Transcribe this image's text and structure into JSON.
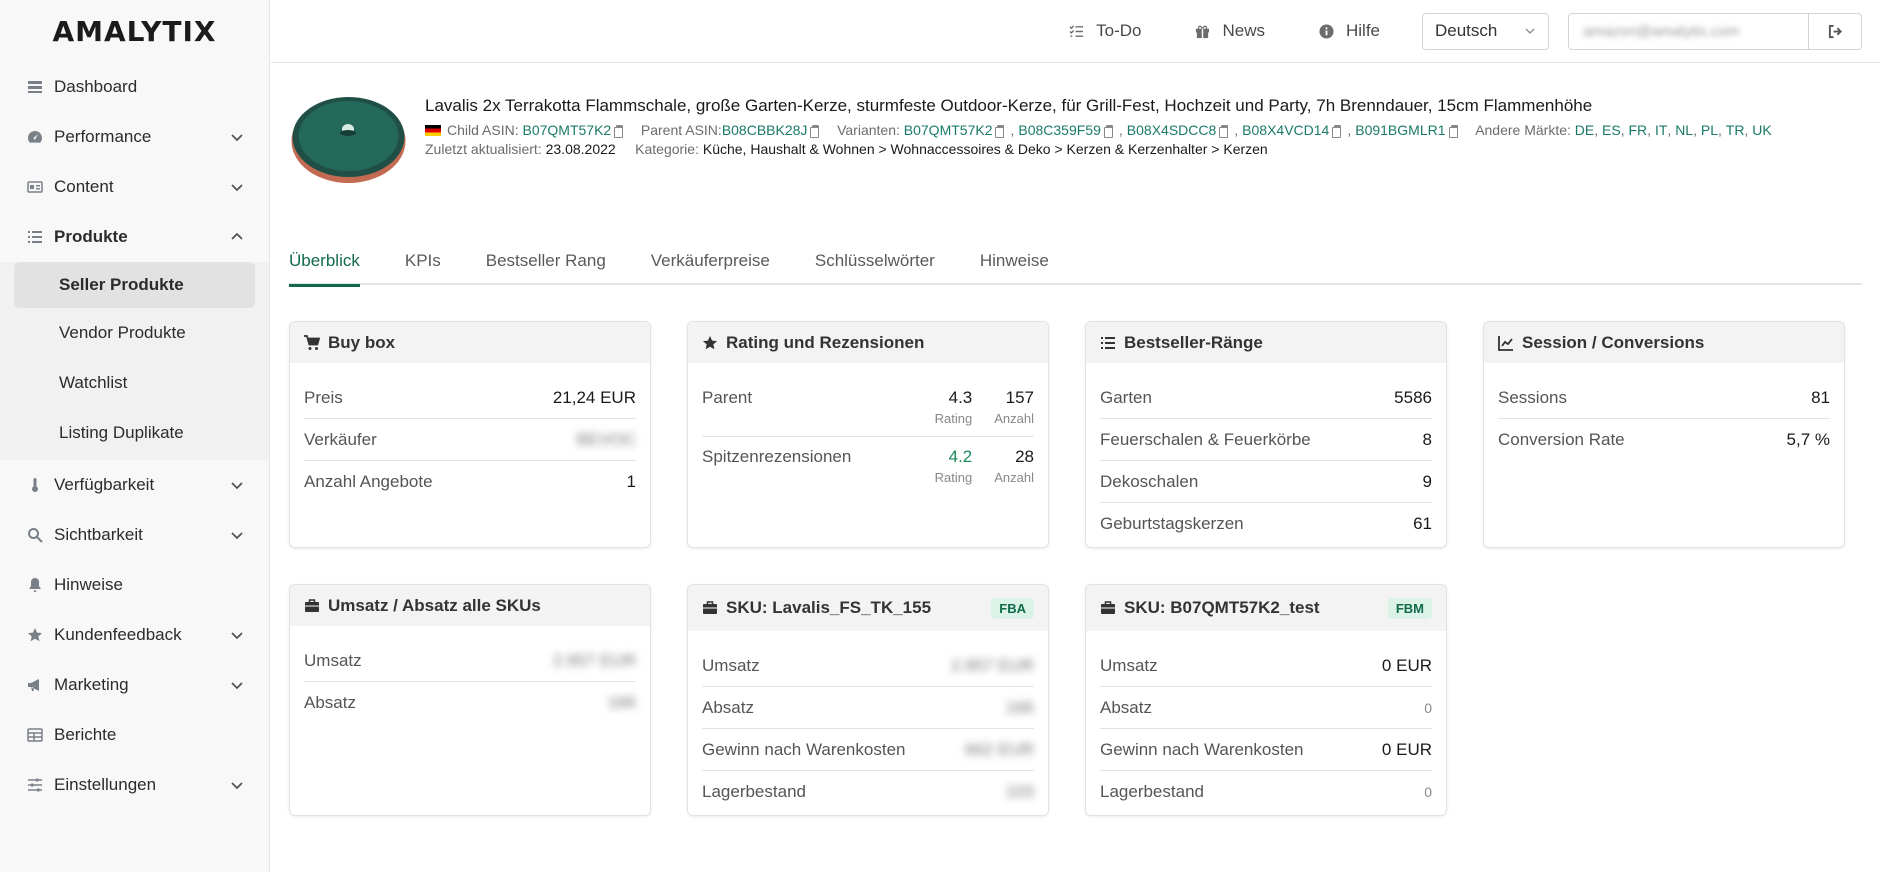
{
  "app": {
    "logo": "AMALYTIX"
  },
  "sidebar": {
    "items": [
      {
        "label": "Dashboard",
        "icon": "dashboard-icon",
        "chevron": false
      },
      {
        "label": "Performance",
        "icon": "gauge-icon",
        "chevron": true
      },
      {
        "label": "Content",
        "icon": "id-card-icon",
        "chevron": true
      },
      {
        "label": "Produkte",
        "icon": "list-icon",
        "chevron": true,
        "expanded": true
      },
      {
        "label": "Verfügbarkeit",
        "icon": "thermometer-icon",
        "chevron": true
      },
      {
        "label": "Sichtbarkeit",
        "icon": "search-icon",
        "chevron": true
      },
      {
        "label": "Hinweise",
        "icon": "bell-icon",
        "chevron": false
      },
      {
        "label": "Kundenfeedback",
        "icon": "star-icon",
        "chevron": true
      },
      {
        "label": "Marketing",
        "icon": "megaphone-icon",
        "chevron": true
      },
      {
        "label": "Berichte",
        "icon": "table-icon",
        "chevron": false
      },
      {
        "label": "Einstellungen",
        "icon": "sliders-icon",
        "chevron": true
      }
    ],
    "sub_items": [
      "Seller Produkte",
      "Vendor Produkte",
      "Watchlist",
      "Listing Duplikate"
    ]
  },
  "header": {
    "todo": "To-Do",
    "news": "News",
    "help": "Hilfe",
    "language": "Deutsch",
    "email": "amazon@amalytix.com"
  },
  "product": {
    "title": "Lavalis 2x Terrakotta Flammschale, große Garten-Kerze, sturmfeste Outdoor-Kerze, für Grill-Fest, Hochzeit und Party, 7h Brenndauer, 15cm Flammenhöhe",
    "child_asin_label": "Child ASIN:",
    "child_asin": "B07QMT57K2",
    "parent_asin_label": "Parent ASIN:",
    "parent_asin": "B08CBBK28J",
    "variants_label": "Varianten:",
    "variants": [
      "B07QMT57K2",
      "B08C359F59",
      "B08X4SDCC8",
      "B08X4VCD14",
      "B091BGMLR1"
    ],
    "markets_label": "Andere Märkte:",
    "markets": [
      "DE",
      "ES",
      "FR",
      "IT",
      "NL",
      "PL",
      "TR",
      "UK"
    ],
    "updated_label": "Zuletzt aktualisiert:",
    "updated": "23.08.2022",
    "category_label": "Kategorie:",
    "category": "Küche, Haushalt & Wohnen > Wohnaccessoires & Deko > Kerzen & Kerzenhalter > Kerzen"
  },
  "tabs": [
    "Überblick",
    "KPIs",
    "Bestseller Rang",
    "Verkäuferpreise",
    "Schlüsselwörter",
    "Hinweise"
  ],
  "cards": {
    "buybox": {
      "title": "Buy box",
      "rows": [
        {
          "label": "Preis",
          "value": "21,24 EUR"
        },
        {
          "label": "Verkäufer",
          "value": "BEVOC"
        },
        {
          "label": "Anzahl Angebote",
          "value": "1"
        }
      ]
    },
    "rating": {
      "title": "Rating und Rezensionen",
      "rows": [
        {
          "label": "Parent",
          "rating": "4.3",
          "count": "157"
        },
        {
          "label": "Spitzenrezensionen",
          "rating": "4.2",
          "count": "28"
        }
      ],
      "rating_sub": "Rating",
      "count_sub": "Anzahl"
    },
    "bestseller": {
      "title": "Bestseller-Ränge",
      "rows": [
        {
          "label": "Garten",
          "value": "5586"
        },
        {
          "label": "Feuerschalen & Feuerkörbe",
          "value": "8"
        },
        {
          "label": "Dekoschalen",
          "value": "9"
        },
        {
          "label": "Geburtstagskerzen",
          "value": "61"
        }
      ]
    },
    "session": {
      "title": "Session / Conversions",
      "rows": [
        {
          "label": "Sessions",
          "value": "81"
        },
        {
          "label": "Conversion Rate",
          "value": "5,7 %"
        }
      ]
    },
    "umsatz_all": {
      "title": "Umsatz / Absatz alle SKUs",
      "rows": [
        {
          "label": "Umsatz",
          "value": "2.957 EUR"
        },
        {
          "label": "Absatz",
          "value": "166"
        }
      ]
    },
    "sku1": {
      "title": "SKU: Lavalis_FS_TK_155",
      "badge": "FBA",
      "rows": [
        {
          "label": "Umsatz",
          "value": "2.957 EUR"
        },
        {
          "label": "Absatz",
          "value": "166"
        },
        {
          "label": "Gewinn nach Warenkosten",
          "value": "662 EUR"
        },
        {
          "label": "Lagerbestand",
          "value": "103"
        }
      ]
    },
    "sku2": {
      "title": "SKU: B07QMT57K2_test",
      "badge": "FBM",
      "rows": [
        {
          "label": "Umsatz",
          "value": "0 EUR"
        },
        {
          "label": "Absatz",
          "value": "0"
        },
        {
          "label": "Gewinn nach Warenkosten",
          "value": "0 EUR"
        },
        {
          "label": "Lagerbestand",
          "value": "0"
        }
      ]
    }
  }
}
